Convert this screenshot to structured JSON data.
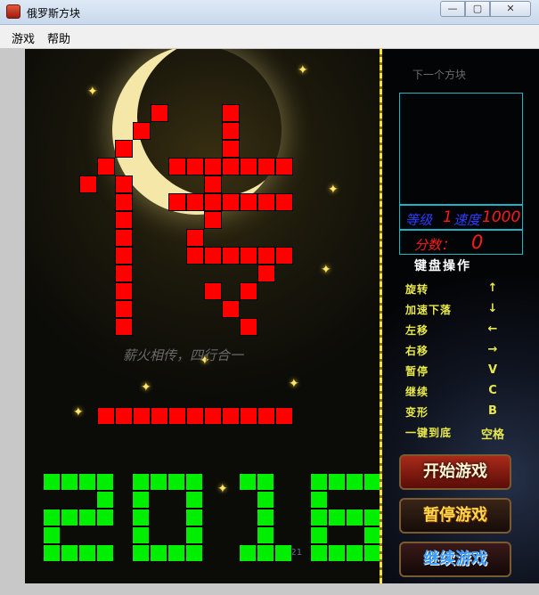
{
  "window": {
    "title": "俄罗斯方块",
    "min_glyph": "—",
    "max_glyph": "▢",
    "close_glyph": "✕"
  },
  "menu": {
    "items": [
      "游戏",
      "帮助"
    ]
  },
  "board": {
    "watermark": "薪火相传，四行合一",
    "coordinate_readout": "1X180Y21",
    "colors": {
      "red": "#ff0000",
      "green": "#00ee00"
    }
  },
  "side": {
    "next_label": "下一个方块",
    "level_label": "等级",
    "level_value": "1",
    "speed_label": "速度",
    "speed_value": "1000",
    "score_label": "分数：",
    "score_value": "0",
    "keyboard_title": "键盘操作",
    "keys": [
      {
        "name": "旋转",
        "key": "↑"
      },
      {
        "name": "加速下落",
        "key": "↓"
      },
      {
        "name": "左移",
        "key": "←"
      },
      {
        "name": "右移",
        "key": "→"
      },
      {
        "name": "暂停",
        "key": "V"
      },
      {
        "name": "继续",
        "key": "C"
      },
      {
        "name": "变形",
        "key": "B"
      },
      {
        "name": "一键到底",
        "key": "空格"
      }
    ],
    "buttons": {
      "start": "开始游戏",
      "pause": "暂停游戏",
      "resume": "继续游戏"
    }
  }
}
